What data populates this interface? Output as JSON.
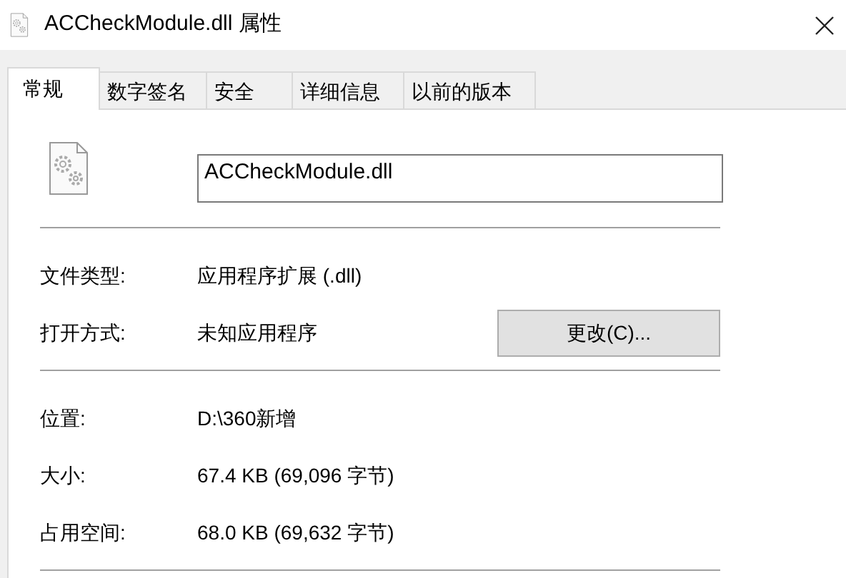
{
  "window": {
    "title": "ACCheckModule.dll 属性"
  },
  "tabs": [
    {
      "label": "常规",
      "selected": true
    },
    {
      "label": "数字签名",
      "selected": false
    },
    {
      "label": "安全",
      "selected": false
    },
    {
      "label": "详细信息",
      "selected": false
    },
    {
      "label": "以前的版本",
      "selected": false
    }
  ],
  "file_name": "ACCheckModule.dll",
  "sections": [
    [
      {
        "label": "文件类型:",
        "value": "应用程序扩展 (.dll)"
      },
      {
        "label": "打开方式:",
        "value": "未知应用程序",
        "button": "更改(C)..."
      }
    ],
    [
      {
        "label": "位置:",
        "value": "D:\\360新增"
      },
      {
        "label": "大小:",
        "value": "67.4 KB (69,096 字节)"
      },
      {
        "label": "占用空间:",
        "value": "68.0 KB (69,632 字节)"
      }
    ]
  ]
}
